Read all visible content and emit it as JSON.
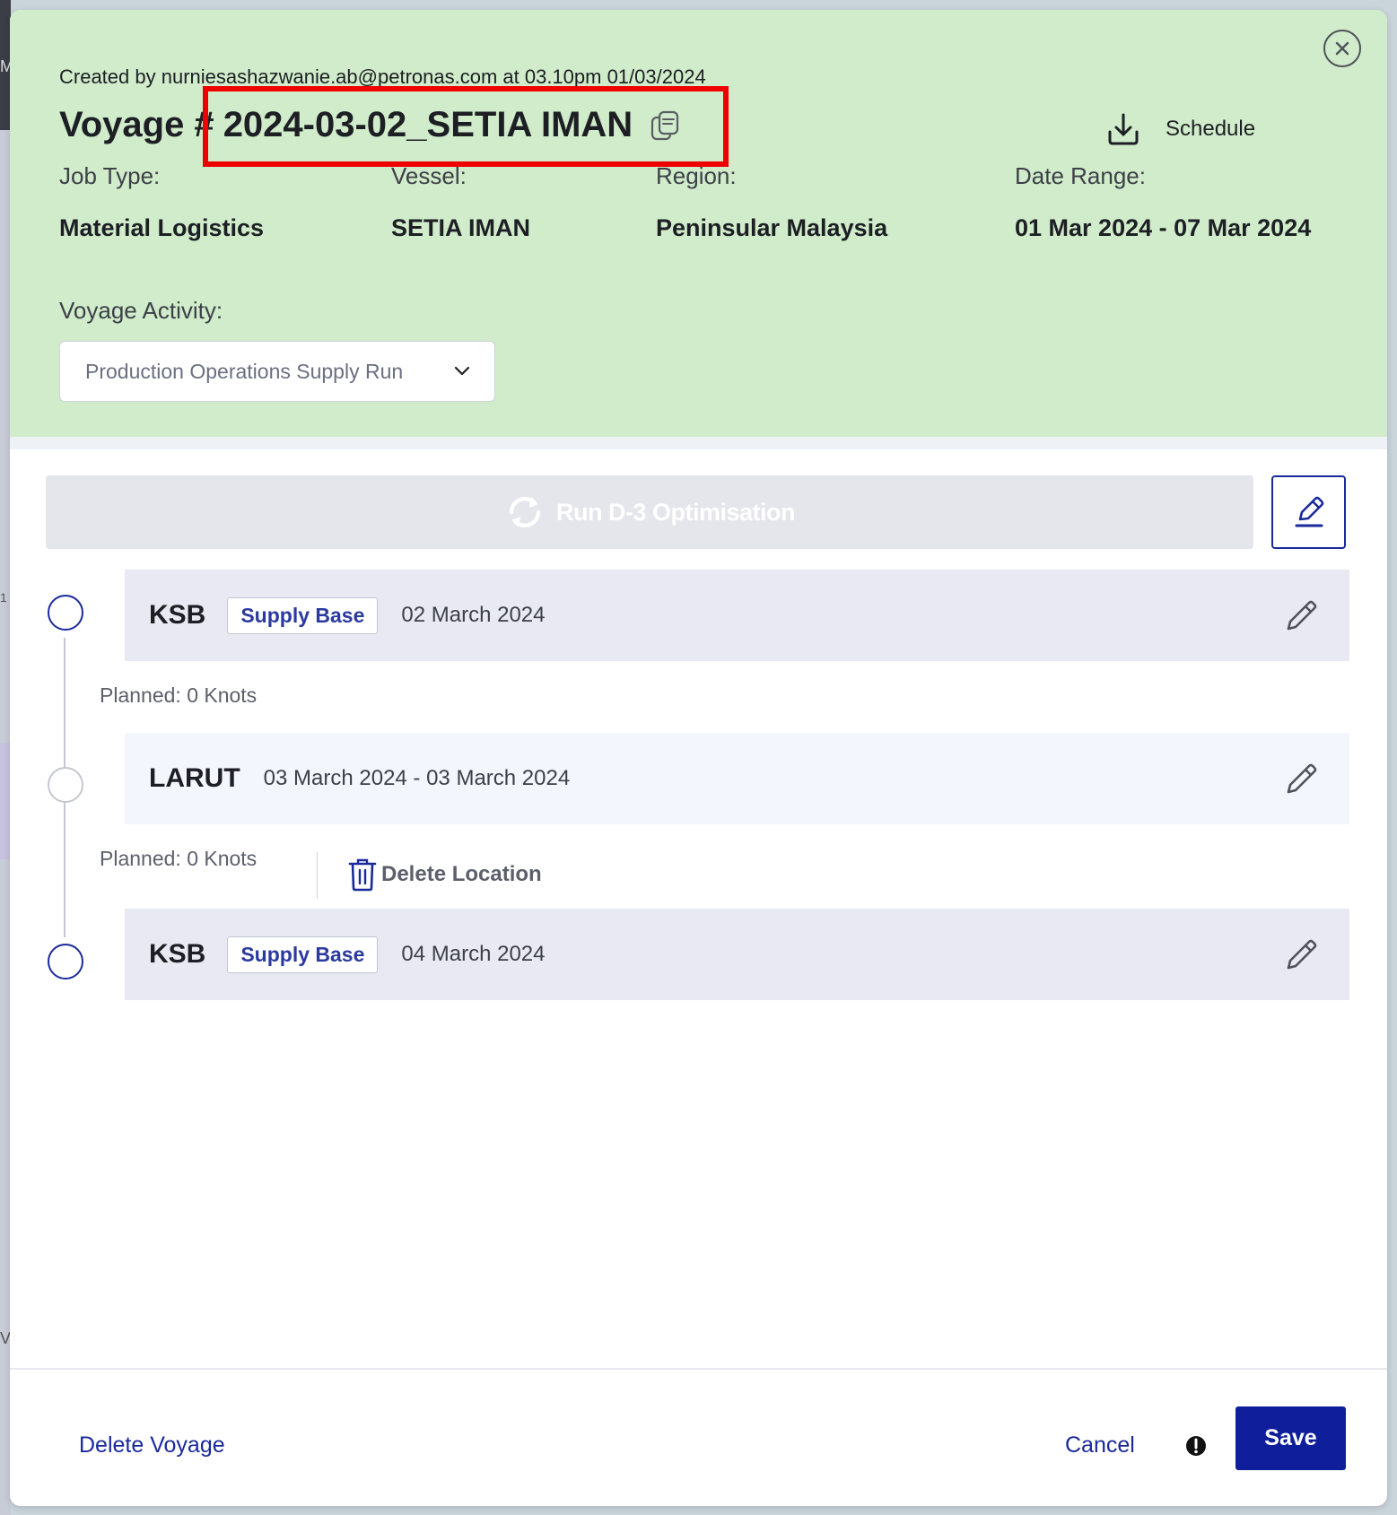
{
  "background": {
    "glyph_top": "M",
    "glyph_mid": "1",
    "glyph_bottom": "VI"
  },
  "modal": {
    "created_by": "Created by nurniesashazwanie.ab@petronas.com at 03.10pm 01/03/2024",
    "voyage_prefix": "Voyage #",
    "voyage_id": "2024-03-02_SETIA IMAN",
    "schedule_label": "Schedule",
    "job_type_label": "Job Type:",
    "job_type_value": "Material Logistics",
    "vessel_label": "Vessel:",
    "vessel_value": "SETIA IMAN",
    "region_label": "Region:",
    "region_value": "Peninsular Malaysia",
    "date_range_label": "Date Range:",
    "date_range_value": "01 Mar 2024 - 07 Mar 2024",
    "activity_label": "Voyage Activity:",
    "activity_value": "Production Operations Supply Run"
  },
  "optimisation": {
    "run_label": "Run D-3 Optimisation"
  },
  "stops": [
    {
      "name": "KSB",
      "tag": "Supply Base",
      "date": "02 March 2024"
    },
    {
      "name": "LARUT",
      "tag": "",
      "date": "03 March 2024 - 03 March 2024"
    },
    {
      "name": "KSB",
      "tag": "Supply Base",
      "date": "04 March 2024"
    }
  ],
  "legs": [
    {
      "planned": "Planned: 0 Knots"
    },
    {
      "planned": "Planned: 0 Knots",
      "delete_label": "Delete Location"
    }
  ],
  "footer": {
    "delete_voyage": "Delete Voyage",
    "cancel": "Cancel",
    "save": "Save"
  },
  "colors": {
    "header_bg": "#d0ecca",
    "accent": "#1a2a9b",
    "save_bg": "#0f1f9c",
    "highlight": "#ee0000"
  }
}
